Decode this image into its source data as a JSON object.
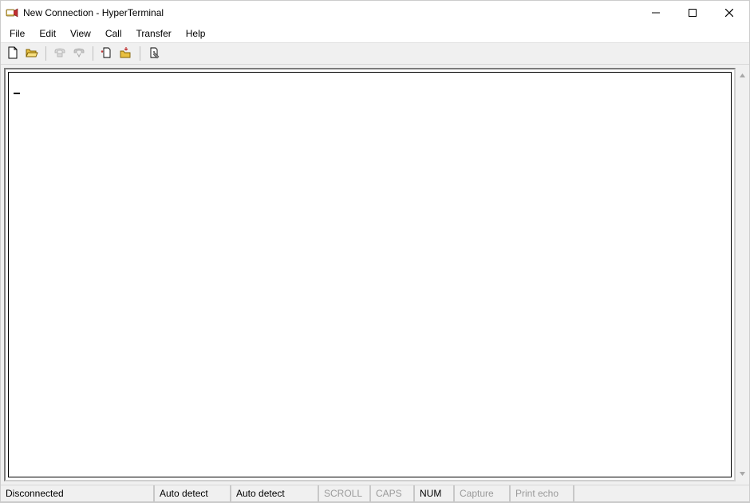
{
  "window": {
    "title": "New Connection - HyperTerminal"
  },
  "menu": {
    "file": "File",
    "edit": "Edit",
    "view": "View",
    "call": "Call",
    "transfer": "Transfer",
    "help": "Help"
  },
  "toolbar": {
    "new": "new-file-icon",
    "open": "open-folder-icon",
    "connect": "phone-connect-icon",
    "disconnect": "phone-disconnect-icon",
    "send": "send-file-icon",
    "receive": "receive-file-icon",
    "properties": "properties-icon"
  },
  "terminal": {
    "content": ""
  },
  "status": {
    "connection": "Disconnected",
    "detect1": "Auto detect",
    "detect2": "Auto detect",
    "scroll": "SCROLL",
    "caps": "CAPS",
    "num": "NUM",
    "capture": "Capture",
    "printecho": "Print echo"
  }
}
